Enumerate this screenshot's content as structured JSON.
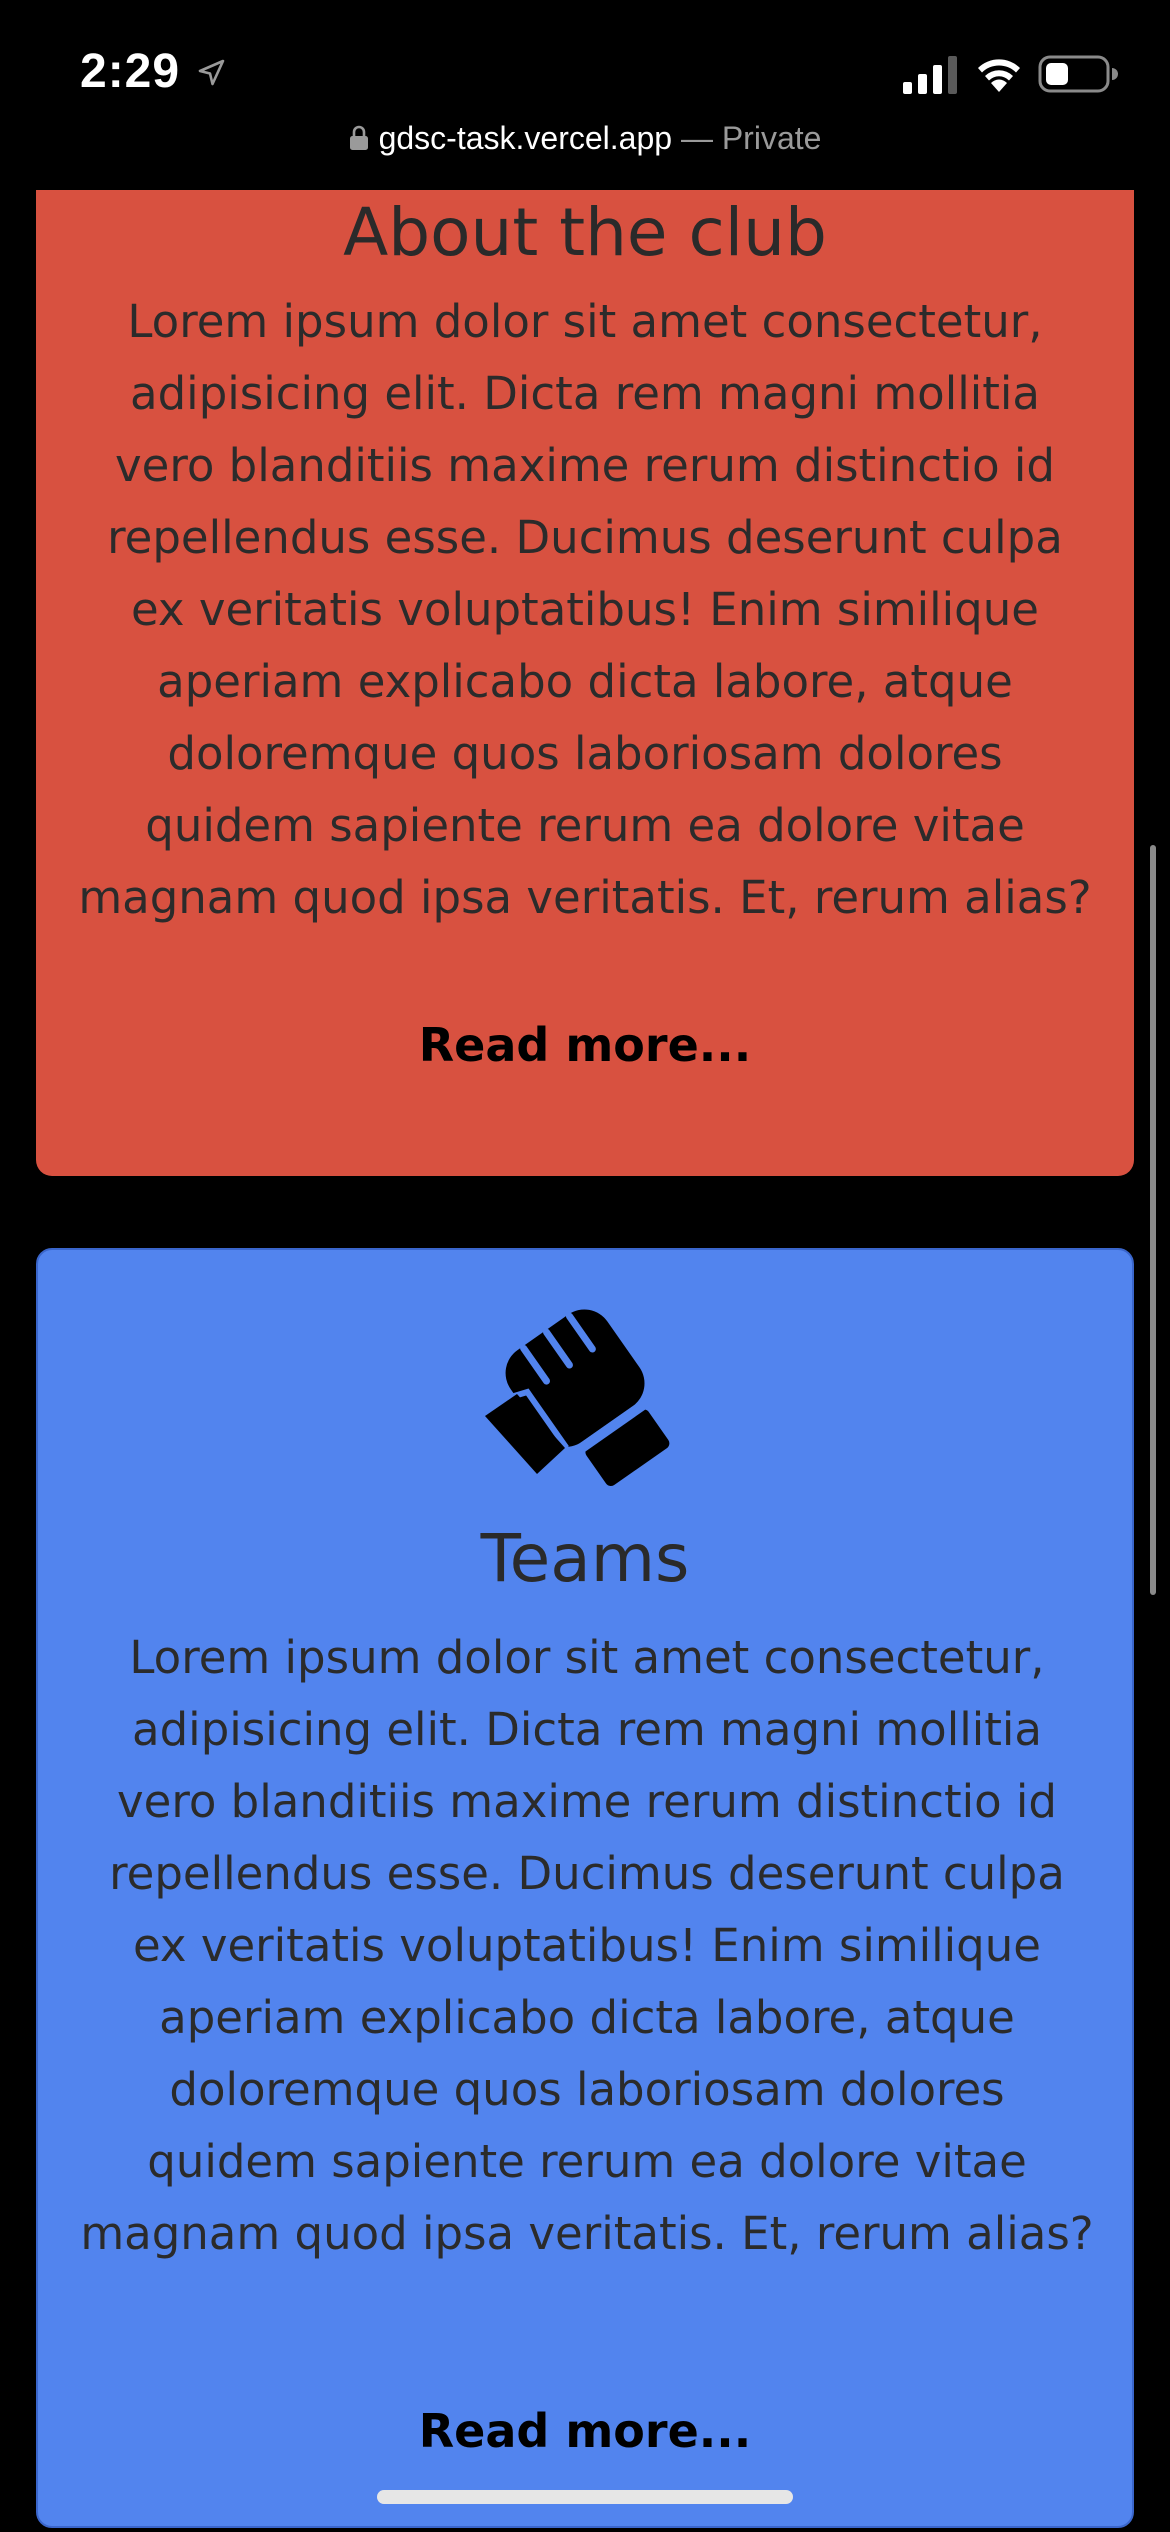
{
  "status_bar": {
    "time": "2:29"
  },
  "url_bar": {
    "domain": "gdsc-task.vercel.app",
    "separator": " — ",
    "mode": "Private"
  },
  "cards": {
    "about": {
      "title": "About the club",
      "body": "Lorem ipsum dolor sit amet consectetur, adipisicing elit. Dicta rem magni mollitia vero blanditiis maxime rerum distinctio id repellendus esse. Ducimus deserunt culpa ex veritatis voluptatibus! Enim similique aperiam explicabo dicta labore, atque doloremque quos laboriosam dolores quidem sapiente rerum ea dolore vitae magnam quod ipsa veritatis. Et, rerum alias?",
      "read_more": "Read more...",
      "color": "#d85140"
    },
    "teams": {
      "title": "Teams",
      "icon": "handshake-icon",
      "body": "Lorem ipsum dolor sit amet consectetur, adipisicing elit. Dicta rem magni mollitia vero blanditiis maxime rerum distinctio id repellendus esse. Ducimus deserunt culpa ex veritatis voluptatibus! Enim similique aperiam explicabo dicta labore, atque doloremque quos laboriosam dolores quidem sapiente rerum ea dolore vitae magnam quod ipsa veritatis. Et, rerum alias?",
      "read_more": "Read more...",
      "color": "#5284ee"
    }
  },
  "icons": {
    "status": [
      "location-arrow-icon",
      "cellular-signal-icon",
      "wifi-icon",
      "battery-icon"
    ],
    "url": "lock-icon"
  }
}
